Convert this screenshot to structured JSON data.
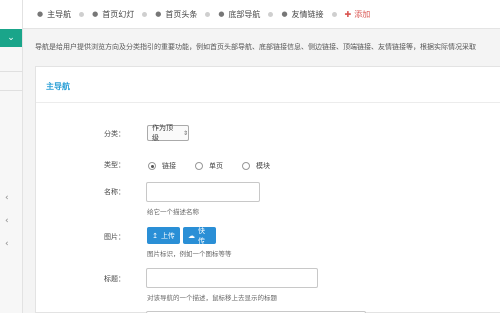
{
  "sidebar": {
    "toggle_icon": "chevron-down-icon"
  },
  "tabs": [
    {
      "label": "主导航"
    },
    {
      "label": "首页幻灯"
    },
    {
      "label": "首页头条"
    },
    {
      "label": "底部导航"
    },
    {
      "label": "友情链接"
    }
  ],
  "add_tab": {
    "label": "添加"
  },
  "notice": "导航是给用户提供浏览方向及分类指引的重要功能，例如首页头部导航、底部链接信息、侧边链接、顶端链接、友情链接等，根据实际情况采取",
  "panel": {
    "title": "主导航"
  },
  "form": {
    "category": {
      "label": "分类：",
      "value": "作为顶级"
    },
    "type": {
      "label": "类型：",
      "options": [
        "链接",
        "单页",
        "模块"
      ],
      "selected": 0
    },
    "name": {
      "label": "名称：",
      "value": "",
      "help": "给它一个描述名称"
    },
    "image": {
      "label": "图片：",
      "upload_label": "上传",
      "quick_label": "快传",
      "help": "图片标识，例如一个图标等等"
    },
    "title": {
      "label": "标题：",
      "value": "",
      "help": "对该导航的一个描述，鼠标移上去显示的标题"
    }
  }
}
